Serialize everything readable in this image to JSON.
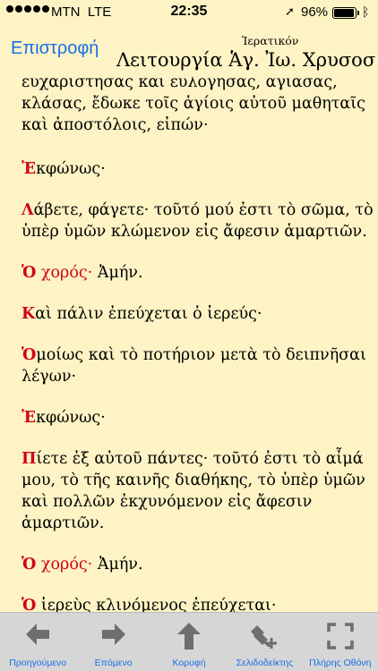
{
  "status_bar": {
    "carrier": "MTN",
    "network": "LTE",
    "time": "22:35",
    "battery_percent": "96%",
    "battery_level": 0.96
  },
  "nav": {
    "back_label": "Επιστροφή",
    "subtitle": "Ἱερατικόν",
    "title": "Λειτουργία Ἁγ. Ἰω. Χρυσοσ"
  },
  "content": {
    "p1": "εὐχαριστήσας καὶ εὐλογήσας, ἁγιάσας, κλάσας, ἔδωκε τοῖς ἁγίοις αὐτοῦ μαθηταῖς καὶ ἀποστόλοις, εἰπών·",
    "p2_initial": "Ἐ",
    "p2_rest": "κφώνως·",
    "p3_initial": "Λ",
    "p3_rest": "άβετε, φάγετε· τοῦτό μού ἐστι τὸ σῶμα, τὸ ὑπὲρ ὑμῶν κλώμενον εἰς ἄφεσιν ἁμαρτιῶν.",
    "p4_initial": "Ὁ",
    "p4_red": " χορός·",
    "p4_rest": " Ἀμήν.",
    "p5_initial": "Κ",
    "p5_rest": "αὶ πάλιν ἐπεύχεται ὁ ἱερεύς·",
    "p6_initial": "Ὁ",
    "p6_rest": "μοίως καὶ τὸ ποτήριον μετὰ τὸ δειπνῆσαι λέγων·",
    "p7_initial": "Ἐ",
    "p7_rest": "κφώνως·",
    "p8_initial": "Π",
    "p8_rest": "ίετε ἐξ αὐτοῦ πάντες· τοῦτό ἐστι τὸ αἷμά μου, τὸ τῆς καινῆς διαθήκης, τὸ ὑπὲρ ὑμῶν καὶ πολλῶν ἐκχυνόμενον εἰς ἄφεσιν ἁμαρτιῶν.",
    "p9_initial": "Ὁ",
    "p9_red": " χορός·",
    "p9_rest": " Ἀμήν.",
    "p10_initial": "Ὁ",
    "p10_rest": " ἱερεὺς κλινόμενος ἐπεύχεται·"
  },
  "toolbar": {
    "previous": "Προηγούμενο",
    "next": "Επόμενο",
    "top": "Κορυφή",
    "bookmarks": "Σελιδοδείκτης",
    "fullscreen": "Πλήρης Οθόνη"
  },
  "colors": {
    "background": "#fdf3c4",
    "accent": "#d0021b",
    "link": "#1a6fe8",
    "toolbar": "#d6d6d6",
    "icon": "#6e6e6e"
  }
}
